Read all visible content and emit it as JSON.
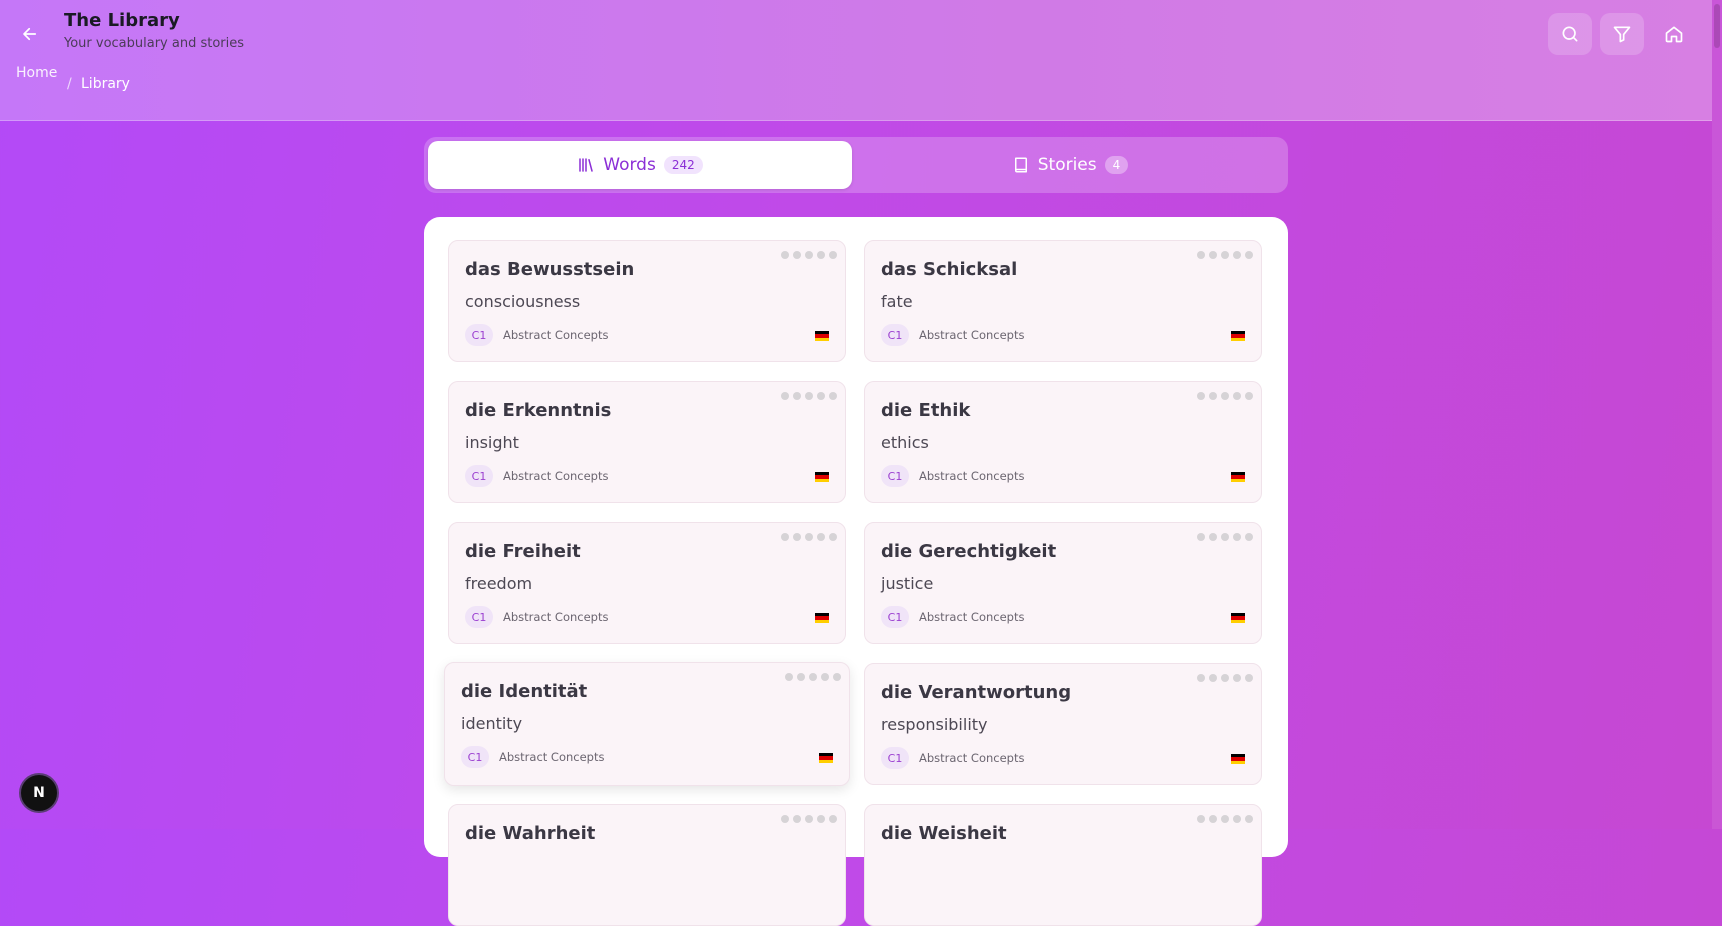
{
  "header": {
    "title": "The Library",
    "subtitle": "Your vocabulary and stories",
    "breadcrumb": {
      "home": "Home",
      "separator": "/",
      "current": "Library"
    },
    "buttons": [
      "arrow-left-icon",
      "search-icon",
      "filter-icon",
      "home-icon"
    ]
  },
  "tabs": {
    "words": {
      "label": "Words",
      "count": "242",
      "icon": "library-icon"
    },
    "stories": {
      "label": "Stories",
      "count": "4",
      "icon": "book-icon"
    }
  },
  "cards": [
    {
      "word": "das Bewusstsein",
      "translation": "consciousness",
      "level": "C1",
      "category": "Abstract Concepts"
    },
    {
      "word": "das Schicksal",
      "translation": "fate",
      "level": "C1",
      "category": "Abstract Concepts"
    },
    {
      "word": "die Erkenntnis",
      "translation": "insight",
      "level": "C1",
      "category": "Abstract Concepts"
    },
    {
      "word": "die Ethik",
      "translation": "ethics",
      "level": "C1",
      "category": "Abstract Concepts"
    },
    {
      "word": "die Freiheit",
      "translation": "freedom",
      "level": "C1",
      "category": "Abstract Concepts"
    },
    {
      "word": "die Gerechtigkeit",
      "translation": "justice",
      "level": "C1",
      "category": "Abstract Concepts"
    },
    {
      "word": "die Identität",
      "translation": "identity",
      "level": "C1",
      "category": "Abstract Concepts"
    },
    {
      "word": "die Verantwortung",
      "translation": "responsibility",
      "level": "C1",
      "category": "Abstract Concepts"
    },
    {
      "word": "die Wahrheit",
      "translation": "",
      "level": "",
      "category": ""
    },
    {
      "word": "die Weisheit",
      "translation": "",
      "level": "",
      "category": ""
    }
  ],
  "fab": {
    "label": "N"
  },
  "colors": {
    "accent": "#8b2fd6",
    "flag": [
      "#000000",
      "#dd0000",
      "#ffce00"
    ]
  }
}
